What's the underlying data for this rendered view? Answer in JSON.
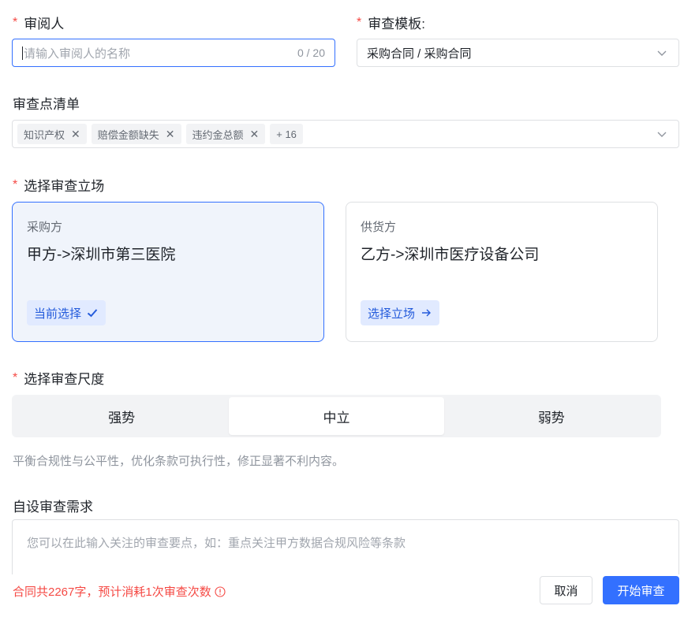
{
  "reviewer": {
    "label": "审阅人",
    "required": "*",
    "placeholder": "请输入审阅人的名称",
    "counter": "0 / 20"
  },
  "template": {
    "label": "审查模板:",
    "required": "*",
    "value": "采购合同 / 采购合同"
  },
  "checklist": {
    "label": "审查点清单",
    "tags": [
      "知识产权",
      "赔偿金额缺失",
      "违约金总额"
    ],
    "more": "+ 16"
  },
  "stance": {
    "label": "选择审查立场",
    "required": "*",
    "options": [
      {
        "role": "采购方",
        "party": "甲方->深圳市第三医院",
        "button": "当前选择",
        "active": true
      },
      {
        "role": "供货方",
        "party": "乙方->深圳市医疗设备公司",
        "button": "选择立场",
        "active": false
      }
    ]
  },
  "scale": {
    "label": "选择审查尺度",
    "required": "*",
    "options": [
      "强势",
      "中立",
      "弱势"
    ],
    "selected": "中立",
    "hint": "平衡合规性与公平性，优化条款可执行性，修正显著不利内容。"
  },
  "custom": {
    "label": "自设审查需求",
    "placeholder": "您可以在此输入关注的审查要点，如：重点关注甲方数据合规风险等条款"
  },
  "footer": {
    "note": "合同共2267字，预计消耗1次审查次数",
    "cancel": "取消",
    "start": "开始审查"
  },
  "colors": {
    "primary": "#3370ff",
    "danger": "#f54a45"
  }
}
